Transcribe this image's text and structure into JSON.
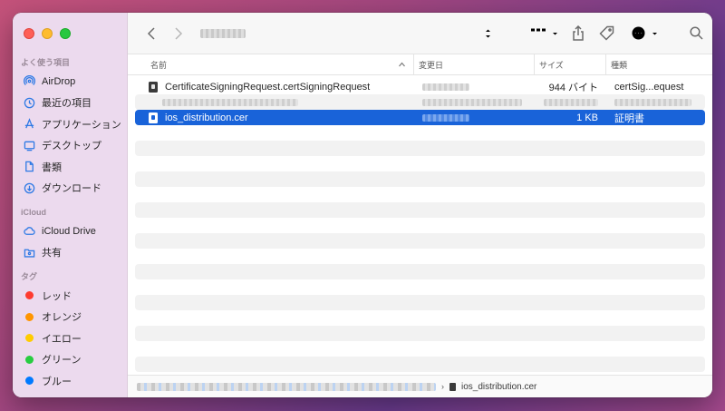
{
  "sidebar": {
    "favorites_title": "よく使う項目",
    "favorites": [
      {
        "label": "AirDrop",
        "icon": "airdrop-icon"
      },
      {
        "label": "最近の項目",
        "icon": "clock-icon"
      },
      {
        "label": "アプリケーション",
        "icon": "applications-icon"
      },
      {
        "label": "デスクトップ",
        "icon": "desktop-icon"
      },
      {
        "label": "書類",
        "icon": "document-icon"
      },
      {
        "label": "ダウンロード",
        "icon": "download-icon"
      }
    ],
    "icloud_title": "iCloud",
    "icloud": [
      {
        "label": "iCloud Drive",
        "icon": "cloud-icon"
      },
      {
        "label": "共有",
        "icon": "shared-folder-icon"
      }
    ],
    "tags_title": "タグ",
    "tags": [
      {
        "label": "レッド",
        "color": "#fe3b30"
      },
      {
        "label": "オレンジ",
        "color": "#ff9500"
      },
      {
        "label": "イエロー",
        "color": "#ffcc00"
      },
      {
        "label": "グリーン",
        "color": "#28cd41"
      },
      {
        "label": "ブルー",
        "color": "#007aff"
      }
    ]
  },
  "columns": {
    "name": "名前",
    "date": "変更日",
    "size": "サイズ",
    "kind": "種類"
  },
  "files": [
    {
      "name": "CertificateSigningRequest.certSigningRequest",
      "size": "944 バイト",
      "kind": "certSig...equest"
    },
    {
      "name": "",
      "size": "",
      "kind": ""
    },
    {
      "name": "ios_distribution.cer",
      "size": "1 KB",
      "kind": "証明書"
    }
  ],
  "pathbar": {
    "current_file": "ios_distribution.cer"
  },
  "colors": {
    "selection": "#1963d9",
    "sidebar_bg": "#ecdaee",
    "accent": "#2f7ae5"
  }
}
